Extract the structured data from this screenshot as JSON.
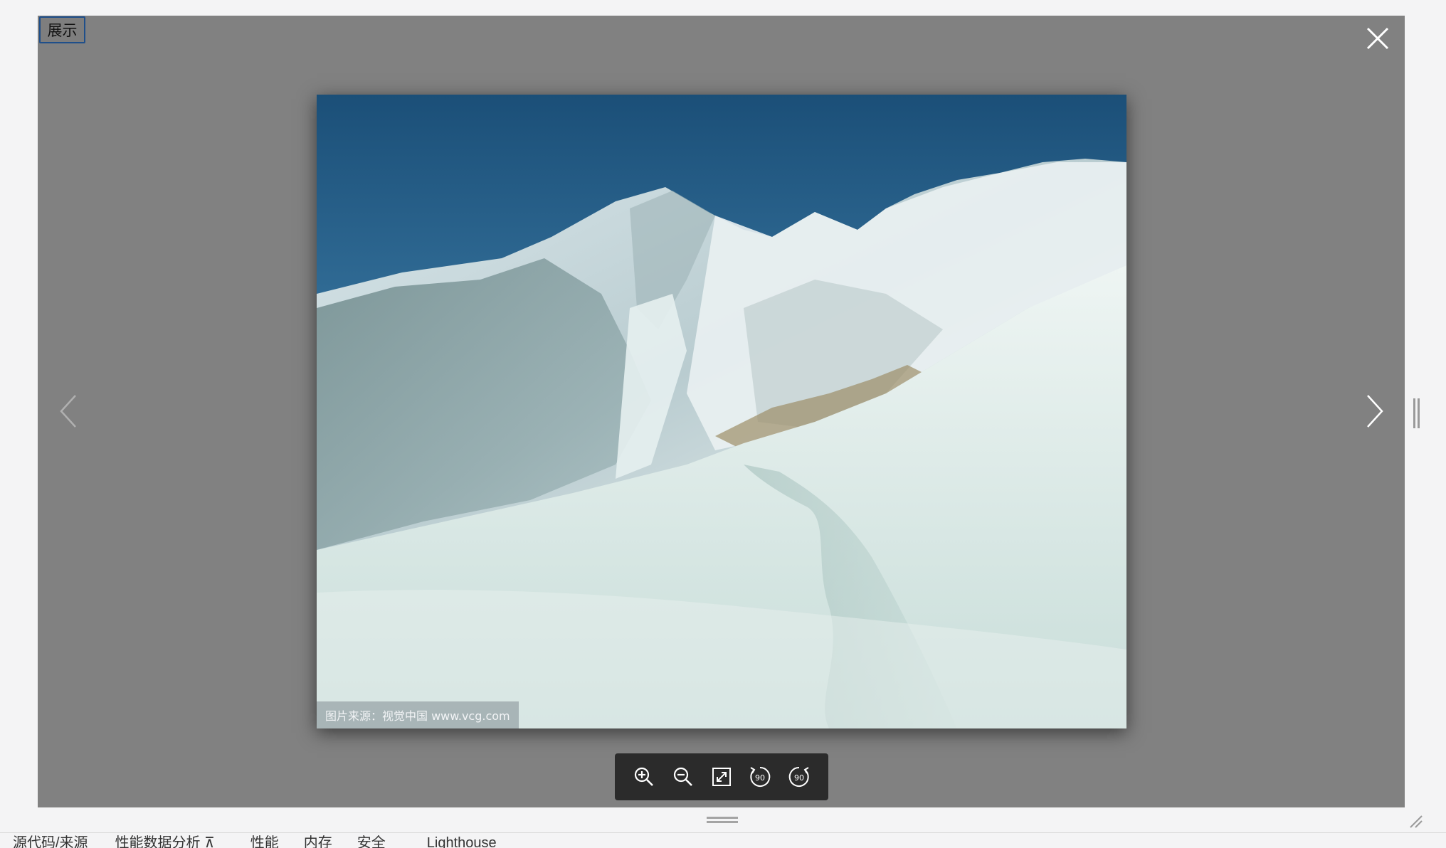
{
  "viewer": {
    "show_label": "展示",
    "watermark": "图片来源：视觉中国 www.vcg.com"
  },
  "toolbar": {
    "tools": [
      {
        "name": "zoom-in",
        "icon": "zoom-in-icon"
      },
      {
        "name": "zoom-out",
        "icon": "zoom-out-icon"
      },
      {
        "name": "fit",
        "icon": "expand-icon"
      },
      {
        "name": "rotate-left",
        "icon": "rotate-left-icon",
        "label": "90"
      },
      {
        "name": "rotate-right",
        "icon": "rotate-right-icon",
        "label": "90"
      }
    ]
  },
  "devtools": {
    "tabs": [
      {
        "label": "源代码/来源"
      },
      {
        "label": "性能数据分析 ⊼"
      },
      {
        "label": "性能"
      },
      {
        "label": "内存"
      },
      {
        "label": "安全"
      },
      {
        "label": "Lighthouse"
      }
    ]
  },
  "colors": {
    "overlay": "#818181",
    "toolbar_bg": "#2b2b2b",
    "show_border": "#1f4f8a"
  }
}
